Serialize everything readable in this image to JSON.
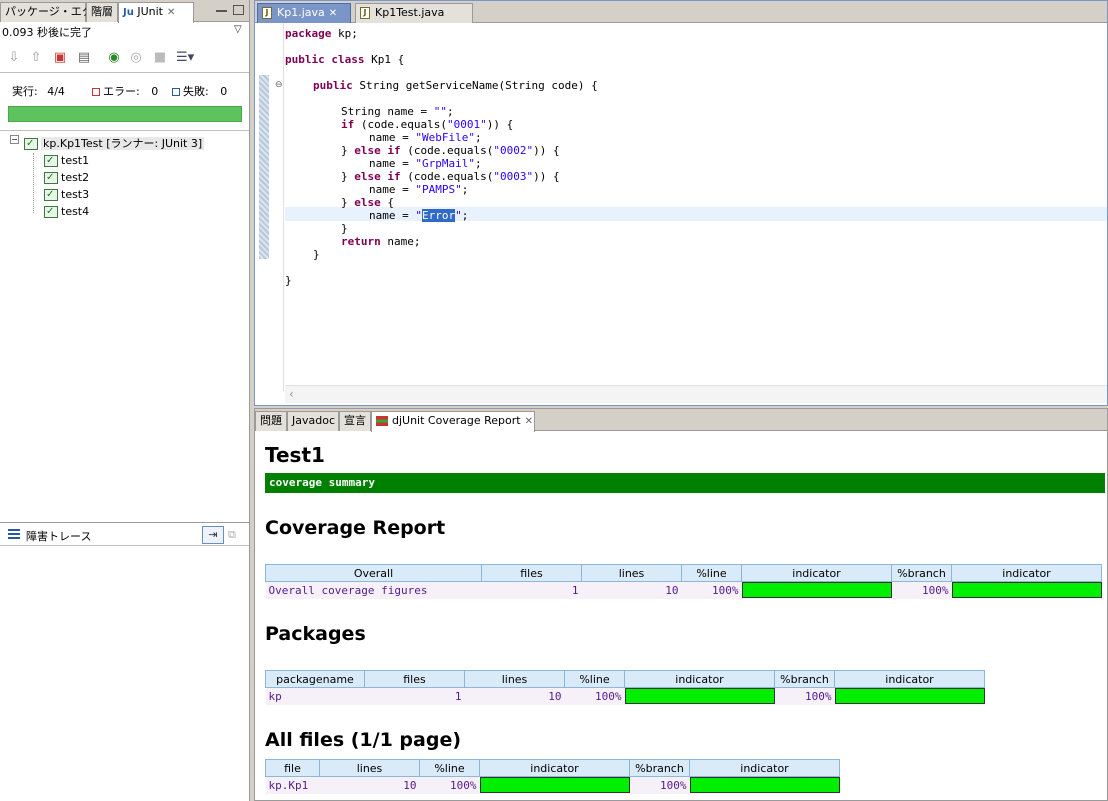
{
  "left_tabs": {
    "package_explorer": "パッケージ・エク…",
    "hierarchy": "階層",
    "junit": "JUnit"
  },
  "junit": {
    "status_text": "0.093 秒後に完了",
    "runs_label": "実行:",
    "runs_value": "4/4",
    "errors_label": "エラー:",
    "errors_value": "0",
    "failures_label": "失敗:",
    "failures_value": "0",
    "progress": 1.0,
    "progress_color": "#5ec25e",
    "tree": {
      "root": "kp.Kp1Test [ランナー: JUnit 3]",
      "tests": [
        "test1",
        "test2",
        "test3",
        "test4"
      ]
    },
    "toolbar_icons": [
      "next-failure-icon",
      "previous-failure-icon",
      "failures-only-icon",
      "scroll-lock-icon",
      "rerun-icon",
      "rerun-failed-icon",
      "stop-icon",
      "history-icon"
    ]
  },
  "trace": {
    "label": "障害トレース"
  },
  "editor": {
    "tabs": [
      "Kp1.java",
      "Kp1Test.java"
    ],
    "active_tab": "Kp1.java",
    "lines": {
      "l1_kw": "package",
      "l1_rest": " kp;",
      "l2_kw1": "public",
      "l2_kw2": "class",
      "l2_rest": " Kp1 {",
      "l3_kw": "public",
      "l3_rest": " String getServiceName(String code) {",
      "l4_a": "String name = ",
      "l4_s": "\"\"",
      "l4_b": ";",
      "l5_kw": "if",
      "l5_a": " (code.equals(",
      "l5_s": "\"0001\"",
      "l5_b": ")) {",
      "l6_a": "name = ",
      "l6_s": "\"WebFile\"",
      "l6_b": ";",
      "l7_a": "} ",
      "l7_kw": "else if",
      "l7_b": " (code.equals(",
      "l7_s": "\"0002\"",
      "l7_c": ")) {",
      "l8_a": "name = ",
      "l8_s": "\"GrpMail\"",
      "l8_b": ";",
      "l9_a": "} ",
      "l9_kw": "else if",
      "l9_b": " (code.equals(",
      "l9_s": "\"0003\"",
      "l9_c": ")) {",
      "l10_a": "name = ",
      "l10_s": "\"PAMPS\"",
      "l10_b": ";",
      "l11_a": "} ",
      "l11_kw": "else",
      "l11_b": " {",
      "l12_a": "name = ",
      "l12_q1": "\"",
      "l12_sel": "Error",
      "l12_q2": "\"",
      "l12_b": ";",
      "l13": "}",
      "l14_kw": "return",
      "l14_rest": " name;",
      "l15": "}",
      "l16": "}"
    }
  },
  "bottom_tabs": {
    "problems": "問題",
    "javadoc": "Javadoc",
    "declaration": "宣言",
    "coverage": "djUnit Coverage Report"
  },
  "report": {
    "title": "Test1",
    "summary_bar": "coverage summary",
    "coverage_heading": "Coverage Report",
    "packages_heading": "Packages",
    "files_heading": "All files (1/1 page)",
    "overall_table": {
      "headers": [
        "Overall",
        "files",
        "lines",
        "%line",
        "indicator",
        "%branch",
        "indicator"
      ],
      "row": {
        "name": "Overall coverage figures",
        "files": "1",
        "lines": "10",
        "line_pct": "100%",
        "line_fill": 1.0,
        "branch_pct": "100%",
        "branch_fill": 1.0
      }
    },
    "packages_table": {
      "headers": [
        "packagename",
        "files",
        "lines",
        "%line",
        "indicator",
        "%branch",
        "indicator"
      ],
      "row": {
        "name": "kp",
        "files": "1",
        "lines": "10",
        "line_pct": "100%",
        "line_fill": 1.0,
        "branch_pct": "100%",
        "branch_fill": 1.0
      }
    },
    "files_table": {
      "headers": [
        "file",
        "lines",
        "%line",
        "indicator",
        "%branch",
        "indicator"
      ],
      "row": {
        "name": "kp.Kp1",
        "lines": "10",
        "line_pct": "100%",
        "line_fill": 1.0,
        "branch_pct": "100%",
        "branch_fill": 1.0
      }
    },
    "bar_color": "#00ee00",
    "summary_color": "#008000"
  }
}
